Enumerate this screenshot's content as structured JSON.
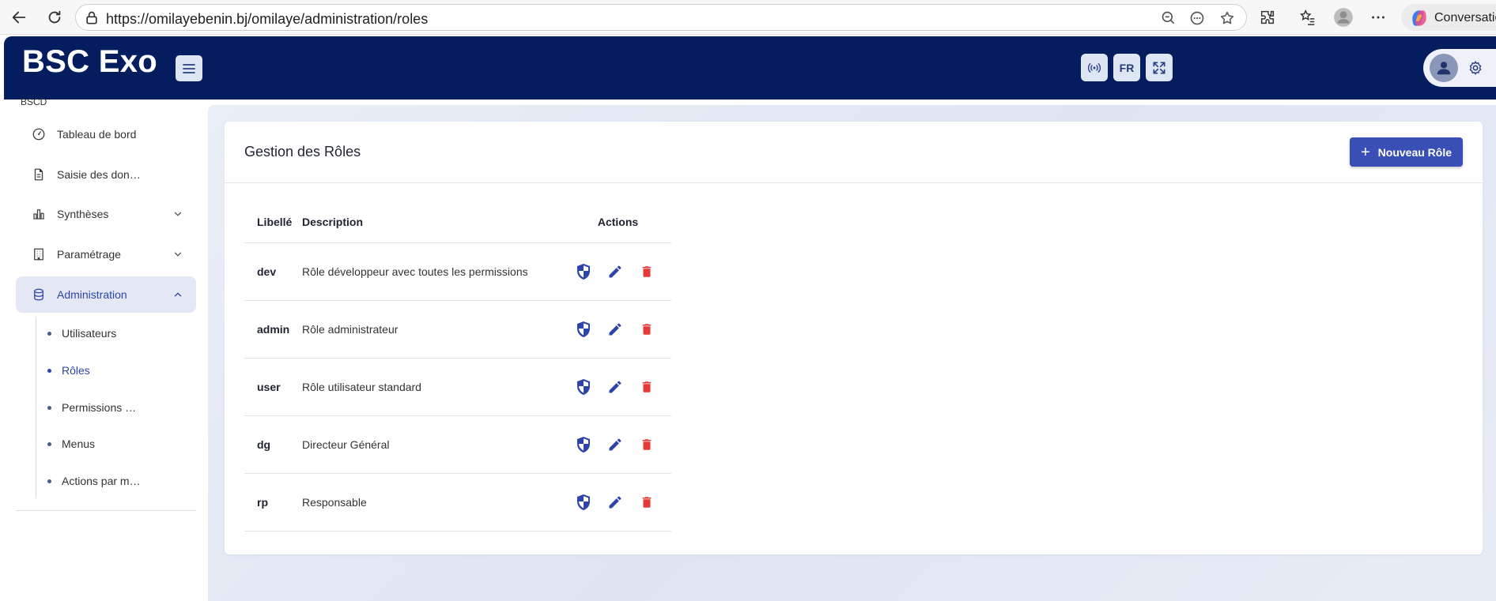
{
  "browser": {
    "url": "https://omilayebenin.bj/omilaye/administration/roles",
    "copilot_label": "Conversatio"
  },
  "header": {
    "brand": "BSC Exo",
    "language": "FR"
  },
  "sidebar": {
    "org_code": "BSCD",
    "items": [
      {
        "label": "Tableau de bord",
        "icon": "gauge-icon"
      },
      {
        "label": "Saisie des don…",
        "icon": "document-icon"
      },
      {
        "label": "Synthèses",
        "icon": "chart-icon"
      },
      {
        "label": "Paramétrage",
        "icon": "building-icon"
      },
      {
        "label": "Administration",
        "icon": "database-icon"
      }
    ],
    "subitems": [
      {
        "label": "Utilisateurs"
      },
      {
        "label": "Rôles"
      },
      {
        "label": "Permissions …"
      },
      {
        "label": "Menus"
      },
      {
        "label": "Actions par m…"
      }
    ]
  },
  "main": {
    "title": "Gestion des Rôles",
    "new_button": "Nouveau Rôle",
    "columns": [
      "Libellé",
      "Description",
      "Actions"
    ],
    "rows": [
      {
        "label": "dev",
        "description": "Rôle développeur avec toutes les permissions"
      },
      {
        "label": "admin",
        "description": "Rôle administrateur"
      },
      {
        "label": "user",
        "description": "Rôle utilisateur standard"
      },
      {
        "label": "dg",
        "description": "Directeur Général"
      },
      {
        "label": "rp",
        "description": "Responsable"
      }
    ]
  },
  "colors": {
    "header_bg": "#031d5e",
    "accent": "#3a4fb5",
    "delete": "#e53935"
  }
}
